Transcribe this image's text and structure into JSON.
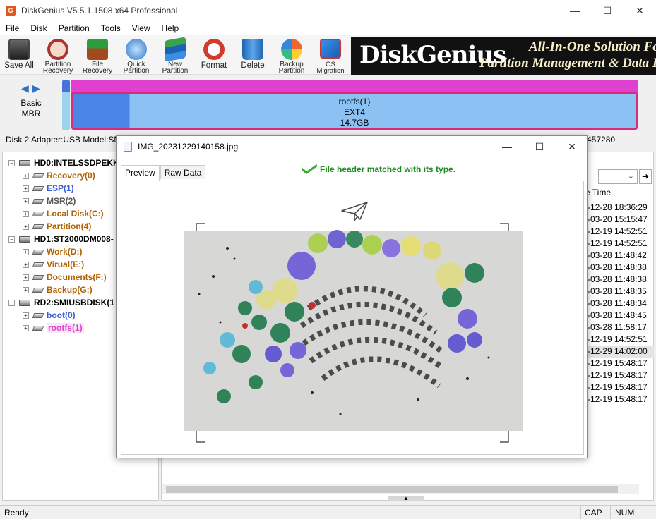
{
  "window": {
    "title": "DiskGenius V5.5.1.1508 x64 Professional",
    "icon": "dg-icon"
  },
  "menu": [
    "File",
    "Disk",
    "Partition",
    "Tools",
    "View",
    "Help"
  ],
  "toolbar": [
    {
      "label": "Save All",
      "icon": "save-icon"
    },
    {
      "label": "Partition Recovery",
      "icon": "partition-recovery-icon"
    },
    {
      "label": "File Recovery",
      "icon": "file-recovery-icon"
    },
    {
      "label": "Quick Partition",
      "icon": "quick-partition-icon"
    },
    {
      "label": "New Partition",
      "icon": "new-partition-icon"
    },
    {
      "label": "Format",
      "icon": "format-icon"
    },
    {
      "label": "Delete",
      "icon": "delete-icon"
    },
    {
      "label": "Backup Partition",
      "icon": "backup-partition-icon"
    },
    {
      "label": "OS Migration",
      "icon": "os-migration-icon"
    }
  ],
  "banner": {
    "brand": "DiskGenius",
    "tagline1": "All-In-One Solution For",
    "tagline2": "Partition Management & Data Re"
  },
  "disk_map": {
    "type_line1": "Basic",
    "type_line2": "MBR",
    "partition_name": "rootfs(1)",
    "partition_fs": "EXT4",
    "partition_size": "14.7GB"
  },
  "disk_info_left": "Disk 2 Adapter:USB  Model:SM",
  "disk_info_right": "457280",
  "tree": [
    {
      "label": "HD0:INTELSSDPEKK",
      "level": 0,
      "color": "#000000"
    },
    {
      "label": "Recovery(0)",
      "level": 1,
      "color": "#b06000"
    },
    {
      "label": "ESP(1)",
      "level": 1,
      "color": "#3a5fd8"
    },
    {
      "label": "MSR(2)",
      "level": 1,
      "color": "#555555"
    },
    {
      "label": "Local Disk(C:)",
      "level": 1,
      "color": "#b06000"
    },
    {
      "label": "Partition(4)",
      "level": 1,
      "color": "#b06000"
    },
    {
      "label": "HD1:ST2000DM008-",
      "level": 0,
      "color": "#000000"
    },
    {
      "label": "Work(D:)",
      "level": 1,
      "color": "#b06000"
    },
    {
      "label": "Virual(E:)",
      "level": 1,
      "color": "#b06000"
    },
    {
      "label": "Documents(F:)",
      "level": 1,
      "color": "#b06000"
    },
    {
      "label": "Backup(G:)",
      "level": 1,
      "color": "#b06000"
    },
    {
      "label": "RD2:SMIUSBDISK(1",
      "level": 0,
      "color": "#000000"
    },
    {
      "label": "boot(0)",
      "level": 1,
      "color": "#3a5fd8"
    },
    {
      "label": "rootfs(1)",
      "level": 1,
      "color": "#e040d0",
      "selected": true
    }
  ],
  "file_list": {
    "column_header": "e Time",
    "times": [
      "-12-28 18:36:29",
      "-03-20 15:15:47",
      "-12-19 14:52:51",
      "-12-19 14:52:51",
      "-03-28 11:48:42",
      "-03-28 11:48:38",
      "-03-28 11:48:38",
      "-03-28 11:48:35",
      "-03-28 11:48:34",
      "-03-28 11:48:45",
      "-03-28 11:58:17",
      "-12-19 14:52:51",
      "-12-29 14:02:00",
      "-12-19 15:48:17",
      "-12-19 15:48:17",
      "-12-19 15:48:17",
      "-12-19 15:48:17"
    ]
  },
  "status": {
    "left": "Ready",
    "cap": "CAP",
    "num": "NUM"
  },
  "dialog": {
    "title": "IMG_20231229140158.jpg",
    "tabs": [
      "Preview",
      "Raw Data"
    ],
    "match_message": "File header matched with its type."
  }
}
